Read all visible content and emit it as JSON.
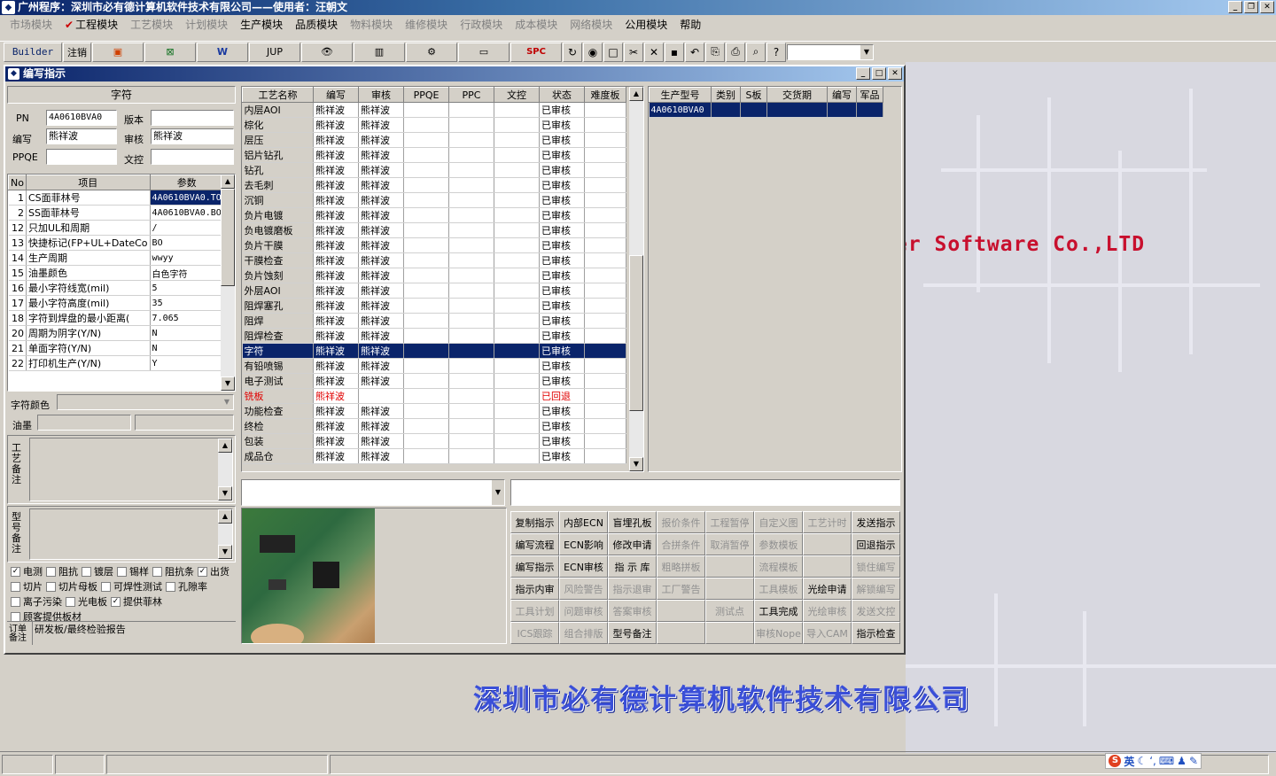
{
  "app": {
    "title": "广州程序：深圳市必有德计算机软件技术有限公司——使用者：汪朝文"
  },
  "menus": [
    {
      "label": "市场模块",
      "enabled": false
    },
    {
      "label": "工程模块",
      "enabled": true,
      "checked": true
    },
    {
      "label": "工艺模块",
      "enabled": false
    },
    {
      "label": "计划模块",
      "enabled": false
    },
    {
      "label": "生产模块",
      "enabled": true
    },
    {
      "label": "品质模块",
      "enabled": true
    },
    {
      "label": "物料模块",
      "enabled": false
    },
    {
      "label": "维修模块",
      "enabled": false
    },
    {
      "label": "行政模块",
      "enabled": false
    },
    {
      "label": "成本模块",
      "enabled": false
    },
    {
      "label": "网络模块",
      "enabled": false
    },
    {
      "label": "公用模块",
      "enabled": true
    },
    {
      "label": "帮助",
      "enabled": true
    }
  ],
  "toolbar": {
    "builder": "Builder",
    "logout": "注销",
    "jup": "JUP",
    "spc": "SPC"
  },
  "window": {
    "title": "编写指示"
  },
  "form": {
    "section_title": "字符",
    "pn_label": "PN",
    "pn_value": "4A0610BVA0",
    "version_label": "版本",
    "version_value": "",
    "author_label": "编写",
    "author_value": "熊祥波",
    "reviewer_label": "审核",
    "reviewer_value": "熊祥波",
    "ppqe_label": "PPQE",
    "ppqe_value": "",
    "doc_label": "文控",
    "doc_value": ""
  },
  "params": {
    "headers": [
      "No",
      "项目",
      "参数"
    ],
    "rows": [
      [
        "1",
        "CS面菲林号",
        "4A0610BVA0.TO"
      ],
      [
        "2",
        "SS面菲林号",
        "4A0610BVA0.BO"
      ],
      [
        "12",
        "只加UL和周期",
        "/"
      ],
      [
        "13",
        "快捷标记(FP+UL+DateCo",
        "BO"
      ],
      [
        "14",
        "生产周期",
        "wwyy"
      ],
      [
        "15",
        "油墨颜色",
        "白色字符"
      ],
      [
        "16",
        "最小字符线宽(mil)",
        "5"
      ],
      [
        "17",
        "最小字符高度(mil)",
        "35"
      ],
      [
        "18",
        "字符到焊盘的最小距离(",
        "7.065"
      ],
      [
        "20",
        "周期为阴字(Y/N)",
        "N"
      ],
      [
        "21",
        "单面字符(Y/N)",
        "N"
      ],
      [
        "22",
        "打印机生产(Y/N)",
        "Y"
      ]
    ]
  },
  "char_color_label": "字符颜色",
  "ink_label": "油墨",
  "process_note_label": "工艺备注",
  "model_note_label": "型号备注",
  "checkboxes": [
    {
      "label": "电测",
      "checked": true
    },
    {
      "label": "阻抗",
      "checked": false
    },
    {
      "label": "镀层",
      "checked": false
    },
    {
      "label": "锡样",
      "checked": false
    },
    {
      "label": "阻抗条",
      "checked": false
    },
    {
      "label": "出货",
      "checked": true
    },
    {
      "label": "切片",
      "checked": false
    },
    {
      "label": "切片母板",
      "checked": false
    },
    {
      "label": "可焊性测试",
      "checked": false
    },
    {
      "label": "孔隙率",
      "checked": false
    },
    {
      "label": "离子污染",
      "checked": false
    },
    {
      "label": "光电板",
      "checked": false
    },
    {
      "label": "提供菲林",
      "checked": true
    },
    {
      "label": "顾客提供板材",
      "checked": false
    }
  ],
  "order_note_label": "订单备注",
  "order_note_value": "研发板/最终检验报告",
  "process": {
    "headers": [
      "工艺名称",
      "编写",
      "审核",
      "PPQE",
      "PPC",
      "文控",
      "状态",
      "难度板"
    ],
    "rows": [
      {
        "name": "内层AOI",
        "author": "熊祥波",
        "reviewer": "熊祥波",
        "status": "已审核"
      },
      {
        "name": "棕化",
        "author": "熊祥波",
        "reviewer": "熊祥波",
        "status": "已审核"
      },
      {
        "name": "层压",
        "author": "熊祥波",
        "reviewer": "熊祥波",
        "status": "已审核"
      },
      {
        "name": "铝片钻孔",
        "author": "熊祥波",
        "reviewer": "熊祥波",
        "status": "已审核"
      },
      {
        "name": "钻孔",
        "author": "熊祥波",
        "reviewer": "熊祥波",
        "status": "已审核"
      },
      {
        "name": "去毛刺",
        "author": "熊祥波",
        "reviewer": "熊祥波",
        "status": "已审核"
      },
      {
        "name": "沉铜",
        "author": "熊祥波",
        "reviewer": "熊祥波",
        "status": "已审核"
      },
      {
        "name": "负片电镀",
        "author": "熊祥波",
        "reviewer": "熊祥波",
        "status": "已审核"
      },
      {
        "name": "负电镀磨板",
        "author": "熊祥波",
        "reviewer": "熊祥波",
        "status": "已审核"
      },
      {
        "name": "负片干膜",
        "author": "熊祥波",
        "reviewer": "熊祥波",
        "status": "已审核"
      },
      {
        "name": "干膜检查",
        "author": "熊祥波",
        "reviewer": "熊祥波",
        "status": "已审核"
      },
      {
        "name": "负片蚀刻",
        "author": "熊祥波",
        "reviewer": "熊祥波",
        "status": "已审核"
      },
      {
        "name": "外层AOI",
        "author": "熊祥波",
        "reviewer": "熊祥波",
        "status": "已审核"
      },
      {
        "name": "阻焊塞孔",
        "author": "熊祥波",
        "reviewer": "熊祥波",
        "status": "已审核"
      },
      {
        "name": "阻焊",
        "author": "熊祥波",
        "reviewer": "熊祥波",
        "status": "已审核"
      },
      {
        "name": "阻焊检查",
        "author": "熊祥波",
        "reviewer": "熊祥波",
        "status": "已审核"
      },
      {
        "name": "字符",
        "author": "熊祥波",
        "reviewer": "熊祥波",
        "status": "已审核",
        "selected": true
      },
      {
        "name": "有铅喷锡",
        "author": "熊祥波",
        "reviewer": "熊祥波",
        "status": "已审核"
      },
      {
        "name": "电子测试",
        "author": "熊祥波",
        "reviewer": "熊祥波",
        "status": "已审核"
      },
      {
        "name": "铣板",
        "author": "熊祥波",
        "reviewer": "",
        "status": "已回退",
        "returned": true
      },
      {
        "name": "功能检查",
        "author": "熊祥波",
        "reviewer": "熊祥波",
        "status": "已审核"
      },
      {
        "name": "终检",
        "author": "熊祥波",
        "reviewer": "熊祥波",
        "status": "已审核"
      },
      {
        "name": "包装",
        "author": "熊祥波",
        "reviewer": "熊祥波",
        "status": "已审核"
      },
      {
        "name": "成品仓",
        "author": "熊祥波",
        "reviewer": "熊祥波",
        "status": "已审核"
      }
    ]
  },
  "products": {
    "headers": [
      "生产型号",
      "类别",
      "S板",
      "交货期",
      "编写",
      "军品"
    ],
    "rows": [
      [
        "4A0610BVA0",
        "",
        "",
        "",
        "",
        ""
      ]
    ]
  },
  "actions": [
    {
      "label": "复制指示",
      "enabled": true
    },
    {
      "label": "内部ECN",
      "enabled": true
    },
    {
      "label": "盲埋孔板",
      "enabled": true
    },
    {
      "label": "报价条件",
      "enabled": false
    },
    {
      "label": "工程暂停",
      "enabled": false
    },
    {
      "label": "自定义图",
      "enabled": false
    },
    {
      "label": "工艺计时",
      "enabled": false
    },
    {
      "label": "发送指示",
      "enabled": true
    },
    {
      "label": "编写流程",
      "enabled": true
    },
    {
      "label": "ECN影响",
      "enabled": true
    },
    {
      "label": "修改申请",
      "enabled": true
    },
    {
      "label": "合拼条件",
      "enabled": false
    },
    {
      "label": "取消暂停",
      "enabled": false
    },
    {
      "label": "参数模板",
      "enabled": false
    },
    {
      "label": "",
      "enabled": false
    },
    {
      "label": "回退指示",
      "enabled": true
    },
    {
      "label": "编写指示",
      "enabled": true
    },
    {
      "label": "ECN审核",
      "enabled": true
    },
    {
      "label": "指 示 库",
      "enabled": true
    },
    {
      "label": "粗略拼板",
      "enabled": false
    },
    {
      "label": "",
      "enabled": false
    },
    {
      "label": "流程模板",
      "enabled": false
    },
    {
      "label": "",
      "enabled": false
    },
    {
      "label": "锁住编写",
      "enabled": false
    },
    {
      "label": "指示内审",
      "enabled": true
    },
    {
      "label": "风险警告",
      "enabled": false
    },
    {
      "label": "指示退审",
      "enabled": false
    },
    {
      "label": "工厂警告",
      "enabled": false
    },
    {
      "label": "",
      "enabled": false
    },
    {
      "label": "工具模板",
      "enabled": false
    },
    {
      "label": "光绘申请",
      "enabled": true
    },
    {
      "label": "解锁编写",
      "enabled": false
    },
    {
      "label": "工具计划",
      "enabled": false
    },
    {
      "label": "问题审核",
      "enabled": false
    },
    {
      "label": "答案审核",
      "enabled": false
    },
    {
      "label": "",
      "enabled": false
    },
    {
      "label": "测试点",
      "enabled": false
    },
    {
      "label": "工具完成",
      "enabled": true
    },
    {
      "label": "光绘审核",
      "enabled": false
    },
    {
      "label": "发送文控",
      "enabled": false
    },
    {
      "label": "ICS跟踪",
      "enabled": false
    },
    {
      "label": "组合排版",
      "enabled": false
    },
    {
      "label": "型号备注",
      "enabled": true
    },
    {
      "label": "",
      "enabled": false
    },
    {
      "label": "",
      "enabled": false
    },
    {
      "label": "审核Nope",
      "enabled": false
    },
    {
      "label": "导入CAM",
      "enabled": false
    },
    {
      "label": "指示检查",
      "enabled": true
    }
  ],
  "background": {
    "company_en": "er Software Co.,LTD",
    "company_cn": "深圳市必有德计算机软件技术有限公司"
  },
  "tray": {
    "ime": "英"
  }
}
